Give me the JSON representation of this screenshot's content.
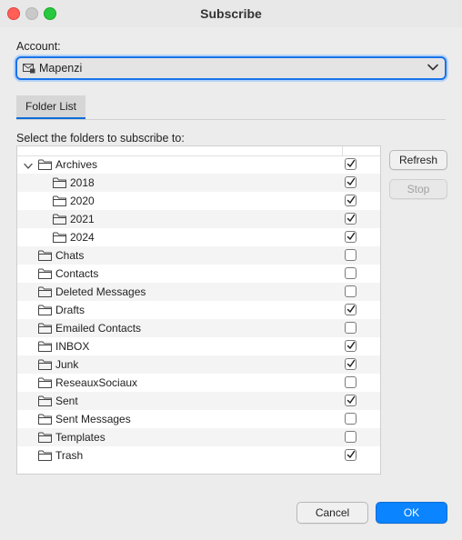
{
  "window": {
    "title": "Subscribe"
  },
  "account": {
    "label": "Account:",
    "selected": "Mapenzi"
  },
  "tabs": [
    {
      "label": "Folder List"
    }
  ],
  "instruction": "Select the folders to subscribe to:",
  "folders": [
    {
      "name": "Archives",
      "level": 0,
      "expandable": true,
      "checked": true
    },
    {
      "name": "2018",
      "level": 1,
      "expandable": false,
      "checked": true
    },
    {
      "name": "2020",
      "level": 1,
      "expandable": false,
      "checked": true
    },
    {
      "name": "2021",
      "level": 1,
      "expandable": false,
      "checked": true
    },
    {
      "name": "2024",
      "level": 1,
      "expandable": false,
      "checked": true
    },
    {
      "name": "Chats",
      "level": 0,
      "expandable": false,
      "checked": false
    },
    {
      "name": "Contacts",
      "level": 0,
      "expandable": false,
      "checked": false
    },
    {
      "name": "Deleted Messages",
      "level": 0,
      "expandable": false,
      "checked": false
    },
    {
      "name": "Drafts",
      "level": 0,
      "expandable": false,
      "checked": true
    },
    {
      "name": "Emailed Contacts",
      "level": 0,
      "expandable": false,
      "checked": false
    },
    {
      "name": "INBOX",
      "level": 0,
      "expandable": false,
      "checked": true
    },
    {
      "name": "Junk",
      "level": 0,
      "expandable": false,
      "checked": true
    },
    {
      "name": "ReseauxSociaux",
      "level": 0,
      "expandable": false,
      "checked": false
    },
    {
      "name": "Sent",
      "level": 0,
      "expandable": false,
      "checked": true
    },
    {
      "name": "Sent Messages",
      "level": 0,
      "expandable": false,
      "checked": false
    },
    {
      "name": "Templates",
      "level": 0,
      "expandable": false,
      "checked": false
    },
    {
      "name": "Trash",
      "level": 0,
      "expandable": false,
      "checked": true
    }
  ],
  "buttons": {
    "refresh": "Refresh",
    "stop": "Stop",
    "cancel": "Cancel",
    "ok": "OK"
  },
  "colors": {
    "accent": "#0a84ff",
    "focus_ring": "#1a73e8"
  }
}
